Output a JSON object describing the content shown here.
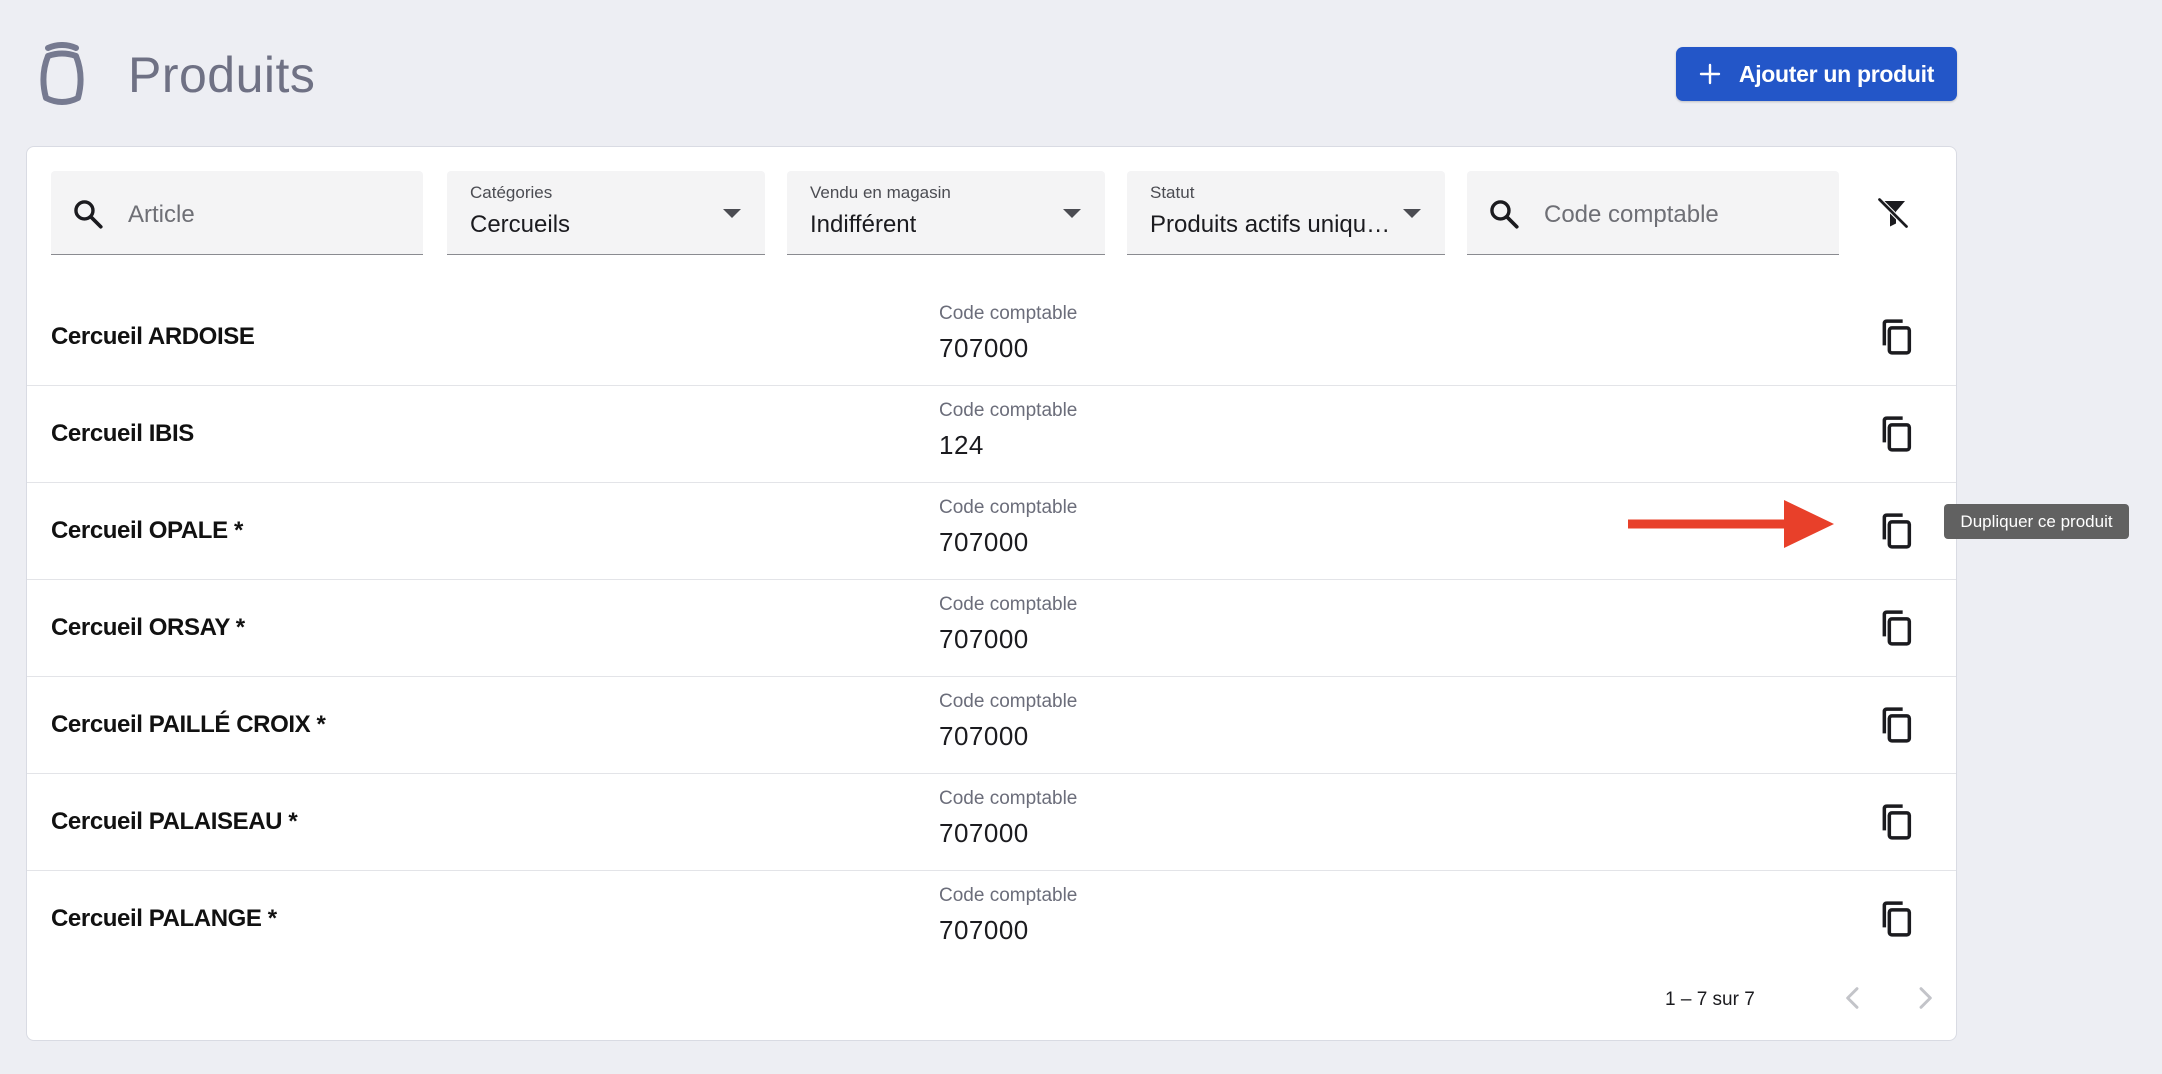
{
  "header": {
    "title": "Produits",
    "icon": "urn-icon",
    "add_button_label": "Ajouter un produit"
  },
  "filters": {
    "article_placeholder": "Article",
    "categories": {
      "label": "Catégories",
      "value": "Cercueils"
    },
    "vendu_en_magasin": {
      "label": "Vendu en magasin",
      "value": "Indifférent"
    },
    "statut": {
      "label": "Statut",
      "value": "Produits actifs unique…"
    },
    "code_placeholder": "Code comptable"
  },
  "products": [
    {
      "name": "Cercueil ARDOISE",
      "code_label": "Code comptable",
      "code": "707000"
    },
    {
      "name": "Cercueil IBIS",
      "code_label": "Code comptable",
      "code": "124"
    },
    {
      "name": "Cercueil OPALE *",
      "code_label": "Code comptable",
      "code": "707000"
    },
    {
      "name": "Cercueil ORSAY *",
      "code_label": "Code comptable",
      "code": "707000"
    },
    {
      "name": "Cercueil PAILLÉ CROIX *",
      "code_label": "Code comptable",
      "code": "707000"
    },
    {
      "name": "Cercueil PALAISEAU *",
      "code_label": "Code comptable",
      "code": "707000"
    },
    {
      "name": "Cercueil PALANGE *",
      "code_label": "Code comptable",
      "code": "707000"
    }
  ],
  "pagination": {
    "range": "1 – 7 sur 7"
  },
  "tooltip": "Dupliquer ce produit",
  "colors": {
    "primary": "#2356c8",
    "annotation": "#e8402a",
    "background": "#edeef3"
  }
}
